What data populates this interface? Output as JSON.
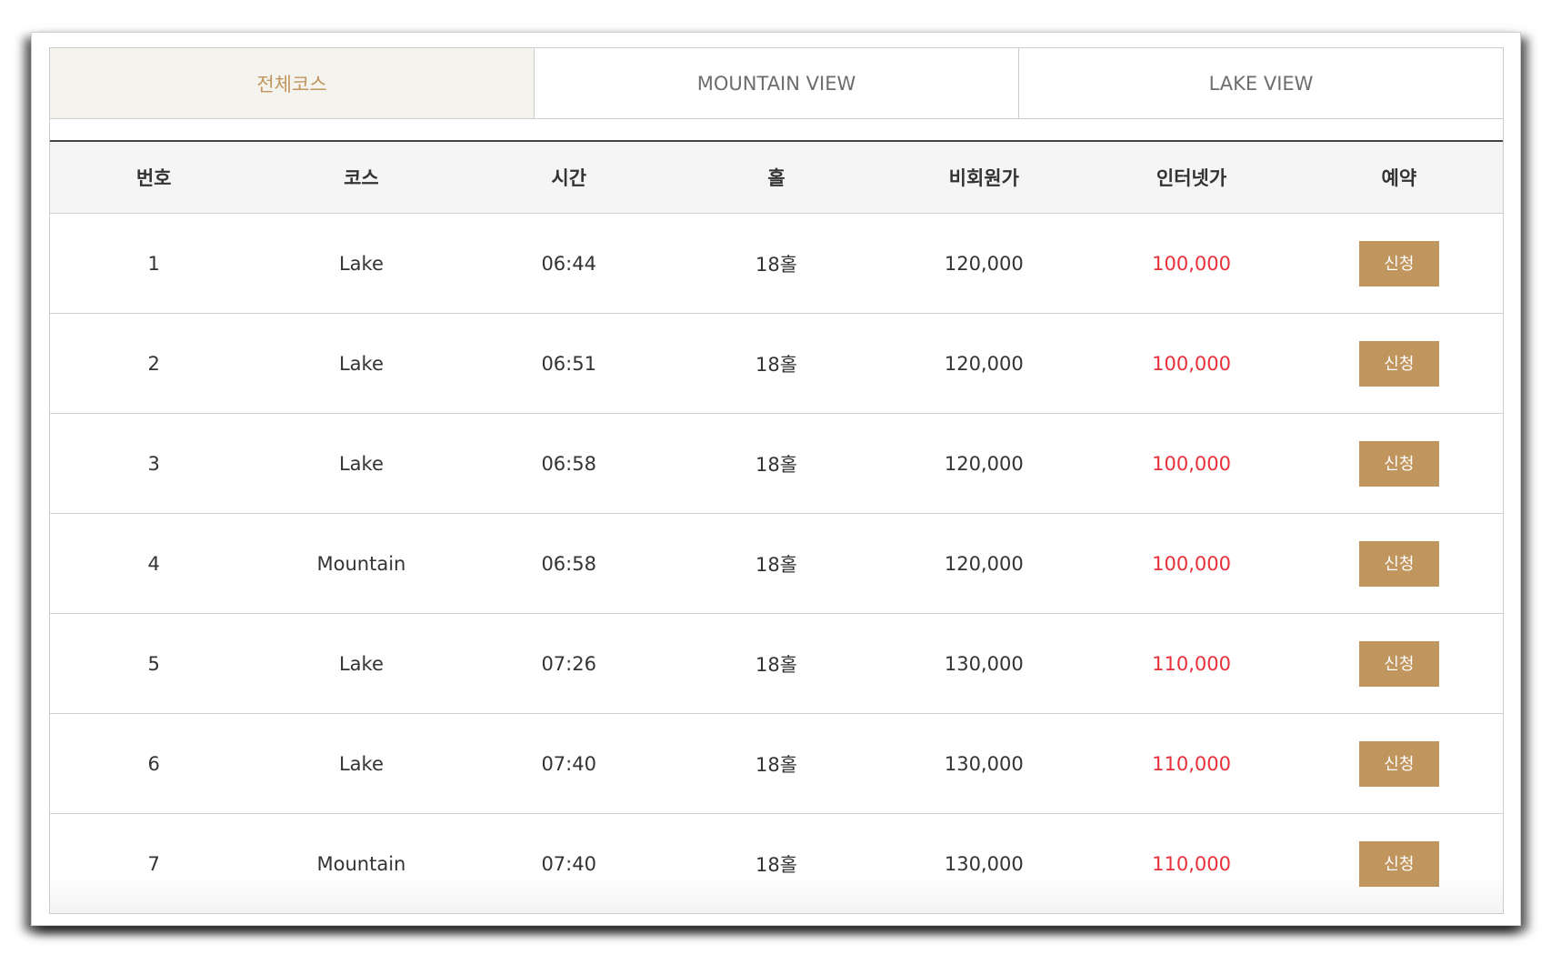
{
  "tabs": [
    {
      "label": "전체코스",
      "active": true
    },
    {
      "label": "MOUNTAIN VIEW",
      "active": false
    },
    {
      "label": "LAKE VIEW",
      "active": false
    }
  ],
  "table": {
    "headers": {
      "no": "번호",
      "course": "코스",
      "time": "시간",
      "holes": "홀",
      "nonmember_price": "비회원가",
      "internet_price": "인터넷가",
      "reserve": "예약"
    },
    "rows": [
      {
        "no": "1",
        "course": "Lake",
        "time": "06:44",
        "holes": "18홀",
        "nonmember_price": "120,000",
        "internet_price": "100,000",
        "button": "신청"
      },
      {
        "no": "2",
        "course": "Lake",
        "time": "06:51",
        "holes": "18홀",
        "nonmember_price": "120,000",
        "internet_price": "100,000",
        "button": "신청"
      },
      {
        "no": "3",
        "course": "Lake",
        "time": "06:58",
        "holes": "18홀",
        "nonmember_price": "120,000",
        "internet_price": "100,000",
        "button": "신청"
      },
      {
        "no": "4",
        "course": "Mountain",
        "time": "06:58",
        "holes": "18홀",
        "nonmember_price": "120,000",
        "internet_price": "100,000",
        "button": "신청"
      },
      {
        "no": "5",
        "course": "Lake",
        "time": "07:26",
        "holes": "18홀",
        "nonmember_price": "130,000",
        "internet_price": "110,000",
        "button": "신청"
      },
      {
        "no": "6",
        "course": "Lake",
        "time": "07:40",
        "holes": "18홀",
        "nonmember_price": "130,000",
        "internet_price": "110,000",
        "button": "신청"
      },
      {
        "no": "7",
        "course": "Mountain",
        "time": "07:40",
        "holes": "18홀",
        "nonmember_price": "130,000",
        "internet_price": "110,000",
        "button": "신청"
      }
    ]
  },
  "colors": {
    "accent": "#c0955e",
    "active_tab_bg": "#f5f3ee",
    "internet_price": "#e8303a",
    "header_bg": "#f5f5f5"
  }
}
